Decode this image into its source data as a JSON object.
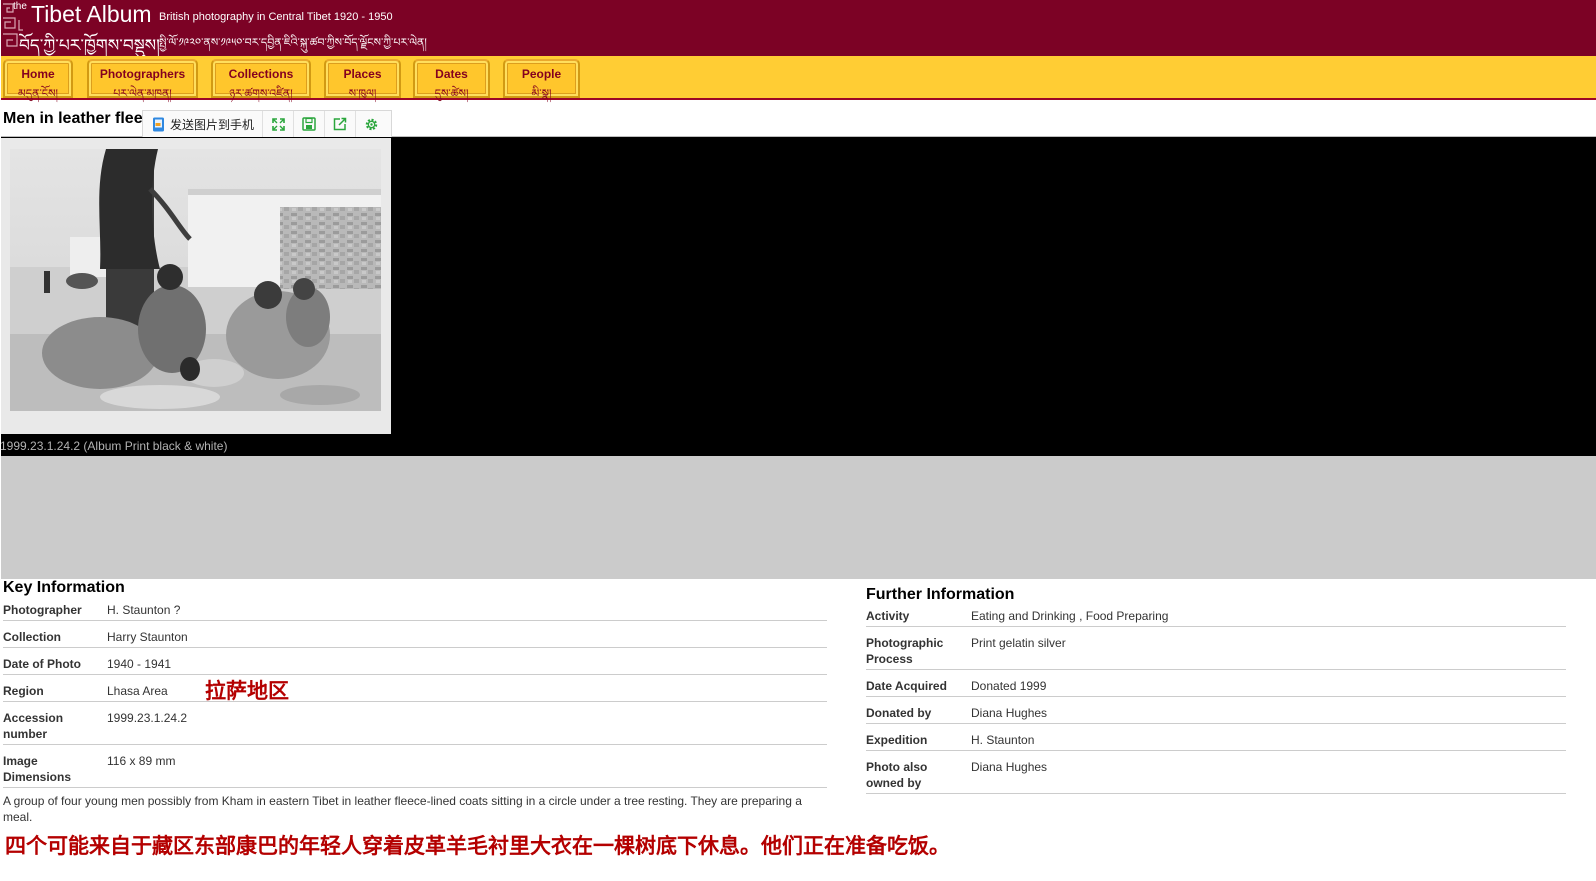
{
  "header": {
    "the": "the",
    "title": "Tibet Album",
    "subtitle": "British photography in Central Tibet 1920 - 1950",
    "title_tibetan": "བོད་ཀྱི་པར་ཁྱོགས་བསྡུས།",
    "subtitle_tibetan": "སྤྱི་ལོ་༡༩༢༠་ནས་༡༩༥༠་བར་དབྱིན་ཇིའི་སྐུ་ཚབ་ཀྱིས་བོད་ལྗོངས་ཀྱི་པར་ལེན།",
    "bg_color": "#7c0225"
  },
  "nav": {
    "bg_color": "#ffcd34",
    "items": [
      {
        "en": "Home",
        "bo": "མདུན་ངོས།"
      },
      {
        "en": "Photographers",
        "bo": "པར་ལེན་མཁན།"
      },
      {
        "en": "Collections",
        "bo": "ཉར་ཚགས་འཛིན།"
      },
      {
        "en": "Places",
        "bo": "ས་ཁུལ།"
      },
      {
        "en": "Dates",
        "bo": "དུས་ཚེས།"
      },
      {
        "en": "People",
        "bo": "མི་སྣ།"
      }
    ]
  },
  "page": {
    "title": "Men in leather fleec"
  },
  "toolbar": {
    "send_to_phone": "发送图片到手机",
    "buttons": [
      "fullscreen-icon",
      "save-icon",
      "share-icon",
      "settings-icon"
    ]
  },
  "photo": {
    "caption": "1999.23.1.24.2 (Album Print black & white)"
  },
  "key_info": {
    "heading": "Key Information",
    "rows": [
      {
        "label": "Photographer",
        "value": "H. Staunton ?"
      },
      {
        "label": "Collection",
        "value": "Harry Staunton"
      },
      {
        "label": "Date of Photo",
        "value": "1940 - 1941"
      },
      {
        "label": "Region",
        "value": "Lhasa Area"
      },
      {
        "label": "Accession number",
        "value": "1999.23.1.24.2"
      },
      {
        "label": "Image Dimensions",
        "value": "116 x 89 mm"
      }
    ],
    "region_annotation": "拉萨地区",
    "description": "A group of four young men possibly from Kham in eastern Tibet in leather fleece-lined coats sitting in a circle under a tree resting. They are preparing a meal.",
    "description_annotation": "四个可能来自于藏区东部康巴的年轻人穿着皮革羊毛衬里大衣在一棵树底下休息。他们正在准备吃饭。"
  },
  "further_info": {
    "heading": "Further Information",
    "rows": [
      {
        "label": "Activity",
        "value": "Eating and Drinking , Food Preparing"
      },
      {
        "label": "Photographic Process",
        "value": "Print gelatin silver"
      },
      {
        "label": "Date Acquired",
        "value": "Donated 1999"
      },
      {
        "label": "Donated by",
        "value": "Diana Hughes"
      },
      {
        "label": "Expedition",
        "value": "H. Staunton"
      },
      {
        "label": "Photo also owned by",
        "value": "Diana Hughes"
      }
    ]
  }
}
